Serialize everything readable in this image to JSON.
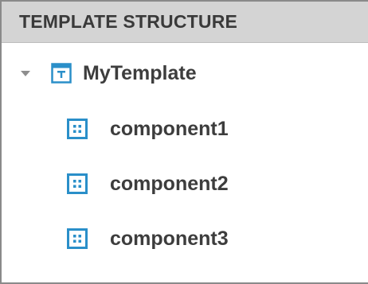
{
  "panel": {
    "title": "TEMPLATE STRUCTURE"
  },
  "tree": {
    "root": {
      "label": "MyTemplate",
      "icon": "template-icon",
      "expanded": true
    },
    "components": [
      {
        "label": "component1",
        "icon": "component-icon"
      },
      {
        "label": "component2",
        "icon": "component-icon"
      },
      {
        "label": "component3",
        "icon": "component-icon"
      }
    ]
  },
  "colors": {
    "header_bg": "#d4d4d4",
    "icon_blue": "#2a8fc9",
    "text": "#3d3d3d",
    "caret": "#8e8e8e"
  }
}
